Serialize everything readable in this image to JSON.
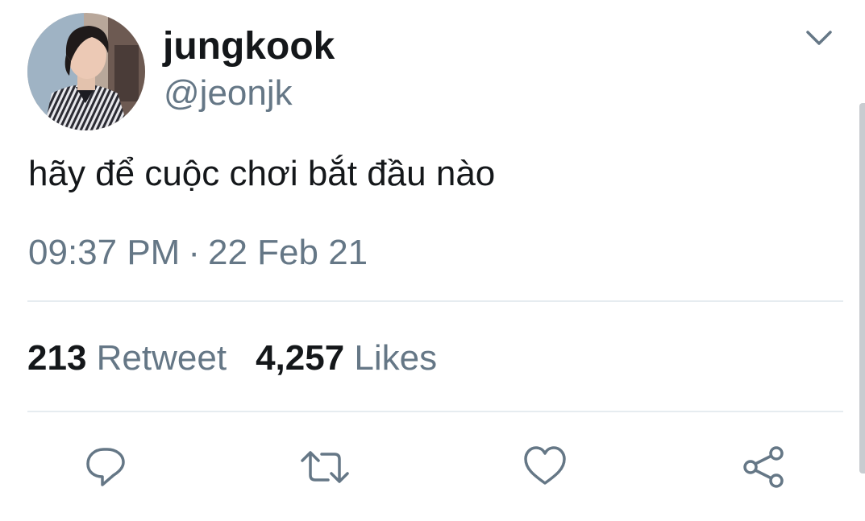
{
  "author": {
    "display_name": "jungkook",
    "handle": "@jeonjk",
    "avatar_icon": "profile-photo"
  },
  "menu": {
    "icon": "chevron-down-icon"
  },
  "tweet": {
    "text": "hãy để cuộc chơi bắt đầu nào",
    "time": "09:37 PM",
    "separator": "·",
    "date": "22 Feb 21"
  },
  "stats": {
    "retweets_count": "213",
    "retweets_label": "Retweet",
    "likes_count": "4,257",
    "likes_label": "Likes"
  },
  "actions": [
    {
      "icon": "reply-icon"
    },
    {
      "icon": "retweet-icon"
    },
    {
      "icon": "like-icon"
    },
    {
      "icon": "share-icon"
    }
  ],
  "colors": {
    "text_primary": "#14171a",
    "text_secondary": "#657786",
    "divider": "#e6ecf0",
    "icon": "#657786"
  }
}
